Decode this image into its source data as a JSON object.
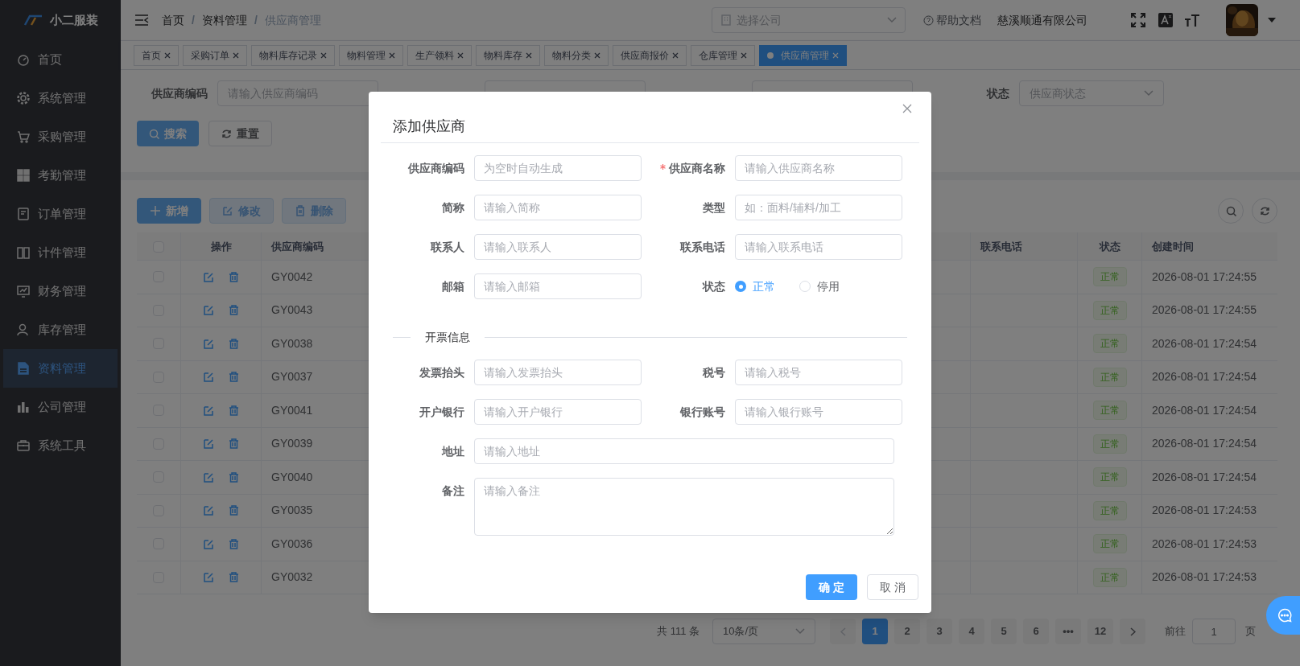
{
  "sidebar": {
    "logo": "小二服装",
    "items": [
      {
        "label": "首页",
        "selected": false
      },
      {
        "label": "系统管理",
        "selected": false
      },
      {
        "label": "采购管理",
        "selected": false
      },
      {
        "label": "考勤管理",
        "selected": false
      },
      {
        "label": "订单管理",
        "selected": false
      },
      {
        "label": "计件管理",
        "selected": false
      },
      {
        "label": "财务管理",
        "selected": false
      },
      {
        "label": "库存管理",
        "selected": false
      },
      {
        "label": "资料管理",
        "selected": true
      },
      {
        "label": "公司管理",
        "selected": false
      },
      {
        "label": "系统工具",
        "selected": false
      }
    ]
  },
  "header": {
    "breadcrumb": [
      "首页",
      "资料管理",
      "供应商管理"
    ],
    "separator": "/",
    "company_select": {
      "placeholder": "选择公司"
    },
    "help": "帮助文档",
    "company": "慈溪顺通有限公司"
  },
  "tags": [
    {
      "label": "首页",
      "selected": false
    },
    {
      "label": "采购订单",
      "selected": false
    },
    {
      "label": "物料库存记录",
      "selected": false
    },
    {
      "label": "物料管理",
      "selected": false
    },
    {
      "label": "生产领料",
      "selected": false
    },
    {
      "label": "物料库存",
      "selected": false
    },
    {
      "label": "物料分类",
      "selected": false
    },
    {
      "label": "供应商报价",
      "selected": false
    },
    {
      "label": "仓库管理",
      "selected": false
    },
    {
      "label": "供应商管理",
      "selected": true
    }
  ],
  "filter": {
    "fields": [
      {
        "label": "供应商编码",
        "placeholder": "请输入供应商编码",
        "kind": "input"
      },
      {
        "kind": "covered"
      },
      {
        "kind": "covered"
      },
      {
        "label": "状态",
        "placeholder": "供应商状态",
        "kind": "select"
      }
    ],
    "search": "搜索",
    "reset": "重置"
  },
  "toolbar": [
    {
      "label": "新增",
      "disabled": false
    },
    {
      "label": "修改",
      "disabled": true
    },
    {
      "label": "删除",
      "disabled": true
    }
  ],
  "table": {
    "select_all": {
      "checked": false
    },
    "columns": [
      "操作",
      "供应商编码",
      "联系电话",
      "状态",
      "创建时间"
    ],
    "rows": [
      {
        "checked": false,
        "code": "GY0042",
        "status": "正常",
        "created": "2026-08-01 17:24:55"
      },
      {
        "checked": false,
        "code": "GY0043",
        "status": "正常",
        "created": "2026-08-01 17:24:55"
      },
      {
        "checked": false,
        "code": "GY0038",
        "status": "正常",
        "created": "2026-08-01 17:24:54"
      },
      {
        "checked": false,
        "code": "GY0037",
        "status": "正常",
        "created": "2026-08-01 17:24:54"
      },
      {
        "checked": false,
        "code": "GY0041",
        "status": "正常",
        "created": "2026-08-01 17:24:54"
      },
      {
        "checked": false,
        "code": "GY0039",
        "status": "正常",
        "created": "2026-08-01 17:24:54"
      },
      {
        "checked": false,
        "code": "GY0040",
        "status": "正常",
        "created": "2026-08-01 17:24:54"
      },
      {
        "checked": false,
        "code": "GY0035",
        "status": "正常",
        "created": "2026-08-01 17:24:53"
      },
      {
        "checked": false,
        "code": "GY0036",
        "status": "正常",
        "created": "2026-08-01 17:24:53"
      },
      {
        "checked": false,
        "code": "GY0032",
        "status": "正常",
        "created": "2026-08-01 17:24:53"
      }
    ]
  },
  "pagination": {
    "total": "共 111 条",
    "page_size": "10条/页",
    "pages": [
      {
        "label": "1",
        "selected": true
      },
      {
        "label": "2",
        "selected": false
      },
      {
        "label": "3",
        "selected": false
      },
      {
        "label": "4",
        "selected": false
      },
      {
        "label": "5",
        "selected": false
      },
      {
        "label": "6",
        "selected": false
      },
      {
        "label": "•••",
        "selected": false
      },
      {
        "label": "12",
        "selected": false
      }
    ],
    "goto_label": "前往",
    "goto_value": "1",
    "goto_suffix": "页"
  },
  "dialog": {
    "title": "添加供应商",
    "rows": [
      [
        {
          "label": "供应商编码",
          "placeholder": "为空时自动生成",
          "required": false,
          "kind": "input"
        },
        {
          "label": "供应商名称",
          "placeholder": "请输入供应商名称",
          "required": true,
          "kind": "input"
        }
      ],
      [
        {
          "label": "简称",
          "placeholder": "请输入简称",
          "required": false,
          "kind": "input"
        },
        {
          "label": "类型",
          "placeholder": "如：面料/辅料/加工",
          "required": false,
          "kind": "input"
        }
      ],
      [
        {
          "label": "联系人",
          "placeholder": "请输入联系人",
          "required": false,
          "kind": "input"
        },
        {
          "label": "联系电话",
          "placeholder": "请输入联系电话",
          "required": false,
          "kind": "input"
        }
      ],
      [
        {
          "label": "邮箱",
          "placeholder": "请输入邮箱",
          "required": false,
          "kind": "input"
        },
        {
          "label": "状态",
          "required": false,
          "kind": "radio",
          "options": [
            {
              "label": "正常",
              "selected": true
            },
            {
              "label": "停用",
              "selected": false
            }
          ]
        }
      ]
    ],
    "section": "开票信息",
    "rows2": [
      [
        {
          "label": "发票抬头",
          "placeholder": "请输入发票抬头",
          "required": false,
          "kind": "input"
        },
        {
          "label": "税号",
          "placeholder": "请输入税号",
          "required": false,
          "kind": "input"
        }
      ],
      [
        {
          "label": "开户银行",
          "placeholder": "请输入开户银行",
          "required": false,
          "kind": "input"
        },
        {
          "label": "银行账号",
          "placeholder": "请输入银行账号",
          "required": false,
          "kind": "input"
        }
      ],
      [
        {
          "label": "地址",
          "placeholder": "请输入地址",
          "required": false,
          "kind": "wide"
        }
      ],
      [
        {
          "label": "备注",
          "placeholder": "请输入备注",
          "required": false,
          "kind": "textarea"
        }
      ]
    ],
    "confirm": "确 定",
    "cancel": "取 消"
  }
}
